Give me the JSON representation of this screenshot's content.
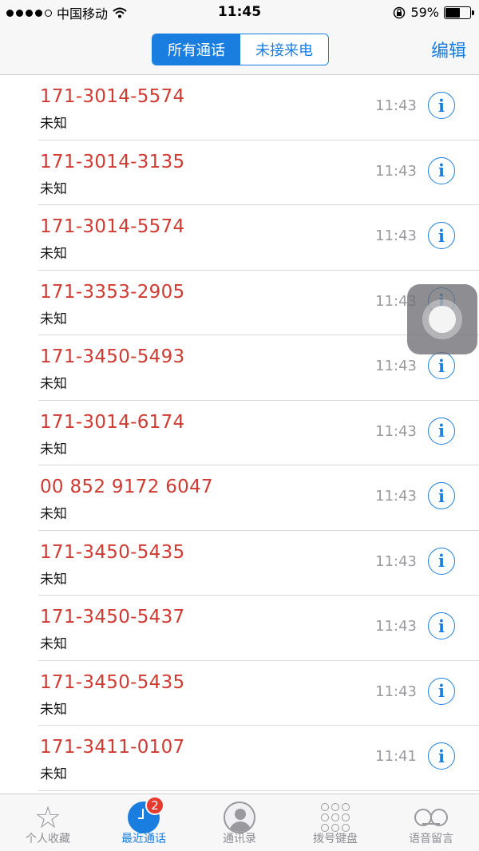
{
  "status_bar": {
    "carrier": "中国移动",
    "time": "11:45",
    "battery_percent": "59%",
    "battery_level": 0.59
  },
  "nav": {
    "segments": [
      "所有通话",
      "未接来电"
    ],
    "active_segment": 0,
    "edit_label": "编辑"
  },
  "calls": [
    {
      "number": "171-3014-5574",
      "label": "未知",
      "time": "11:43",
      "info": "i"
    },
    {
      "number": "171-3014-3135",
      "label": "未知",
      "time": "11:43",
      "info": "i"
    },
    {
      "number": "171-3014-5574",
      "label": "未知",
      "time": "11:43",
      "info": "i"
    },
    {
      "number": "171-3353-2905",
      "label": "未知",
      "time": "11:43",
      "info": "i"
    },
    {
      "number": "171-3450-5493",
      "label": "未知",
      "time": "11:43",
      "info": "i"
    },
    {
      "number": "171-3014-6174",
      "label": "未知",
      "time": "11:43",
      "info": "i"
    },
    {
      "number": "00 852 9172 6047",
      "label": "未知",
      "time": "11:43",
      "info": "i"
    },
    {
      "number": "171-3450-5435",
      "label": "未知",
      "time": "11:43",
      "info": "i"
    },
    {
      "number": "171-3450-5437",
      "label": "未知",
      "time": "11:43",
      "info": "i"
    },
    {
      "number": "171-3450-5435",
      "label": "未知",
      "time": "11:43",
      "info": "i"
    },
    {
      "number": "171-3411-0107",
      "label": "未知",
      "time": "11:41",
      "info": "i"
    }
  ],
  "tabs": [
    {
      "label": "个人收藏",
      "icon": "star-icon"
    },
    {
      "label": "最近通话",
      "icon": "clock-icon",
      "badge": "2"
    },
    {
      "label": "通讯录",
      "icon": "contacts-icon"
    },
    {
      "label": "拨号键盘",
      "icon": "keypad-icon"
    },
    {
      "label": "语音留言",
      "icon": "voicemail-icon"
    }
  ],
  "active_tab": 1,
  "colors": {
    "accent": "#1a7ee0",
    "missed_call": "#cf3b32",
    "badge": "#e53a30"
  }
}
